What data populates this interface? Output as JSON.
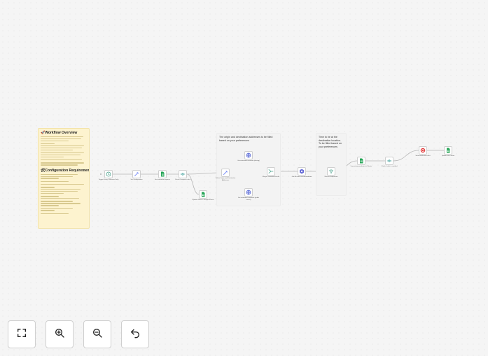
{
  "notes": {
    "overview": {
      "title": "🚀Workflow Overview",
      "config_title": "🛠Configuration Requirements"
    },
    "addresses": {
      "text": "The origin and destination addresses to be filled based on your preferences"
    },
    "time": {
      "text": "Time to be at the destination location. To be filled based on your preferences"
    }
  },
  "nodes": [
    {
      "id": "trigger",
      "icon": "clock-icon",
      "color": "#46a08a",
      "label": "Trigger Every 5 Minutes Daily",
      "sub": ""
    },
    {
      "id": "set-config",
      "icon": "pencil-icon",
      "color": "#7a8ef7",
      "label": "Set Configuration",
      "sub": ""
    },
    {
      "id": "read-sheet",
      "icon": "sheets-icon",
      "color": "#23a455",
      "label": "Get commute requests",
      "sub": ""
    },
    {
      "id": "filter-1",
      "icon": "filter-icon",
      "color": "#4aa5a0",
      "label": "Check if request is due",
      "sub": ""
    },
    {
      "id": "update-sheet-1",
      "icon": "sheets-icon",
      "color": "#23a455",
      "label": "Update status in Google Sheets",
      "sub": ""
    },
    {
      "id": "set-addresses",
      "icon": "pencil-icon",
      "color": "#7a8ef7",
      "label": "Define Origin and Destination Addresses",
      "sub": ""
    },
    {
      "id": "maps-1",
      "icon": "globe-icon",
      "color": "#5b6bd8",
      "label": "Get estimated commute (driving)",
      "sub": ""
    },
    {
      "id": "maps-2",
      "icon": "globe-icon",
      "color": "#5b6bd8",
      "label": "Get estimated commute (public transit)",
      "sub": ""
    },
    {
      "id": "merge",
      "icon": "merge-icon",
      "color": "#46a08a",
      "label": "Merge Commute Results",
      "sub": ""
    },
    {
      "id": "ai",
      "icon": "ai-icon",
      "color": "#6a6fd8",
      "label": "Get AI route recommendation",
      "sub": ""
    },
    {
      "id": "wait",
      "icon": "wait-icon",
      "color": "#46a08a",
      "label": "Wait until departure",
      "sub": ""
    },
    {
      "id": "update-sheet-2",
      "icon": "sheets-icon",
      "color": "#23a455",
      "label": "Log recommendation to Sheets",
      "sub": ""
    },
    {
      "id": "filter-2",
      "icon": "filter-icon",
      "color": "#4aa5a0",
      "label": "Check if alert is needed",
      "sub": ""
    },
    {
      "id": "alert",
      "icon": "alert-icon",
      "color": "#e23b3b",
      "label": "Send notification alert",
      "sub": ""
    },
    {
      "id": "update-sheet-3",
      "icon": "sheets-icon",
      "color": "#23a455",
      "label": "Update alert status",
      "sub": ""
    }
  ],
  "controls": {
    "fit": "fit-view-icon",
    "zoom_in": "zoom-in-icon",
    "zoom_out": "zoom-out-icon",
    "undo": "undo-icon"
  },
  "colors": {
    "sticky_yellow": "#fdf3cf",
    "sticky_gray": "#f3f3f3",
    "connection": "#b5b5b5"
  }
}
